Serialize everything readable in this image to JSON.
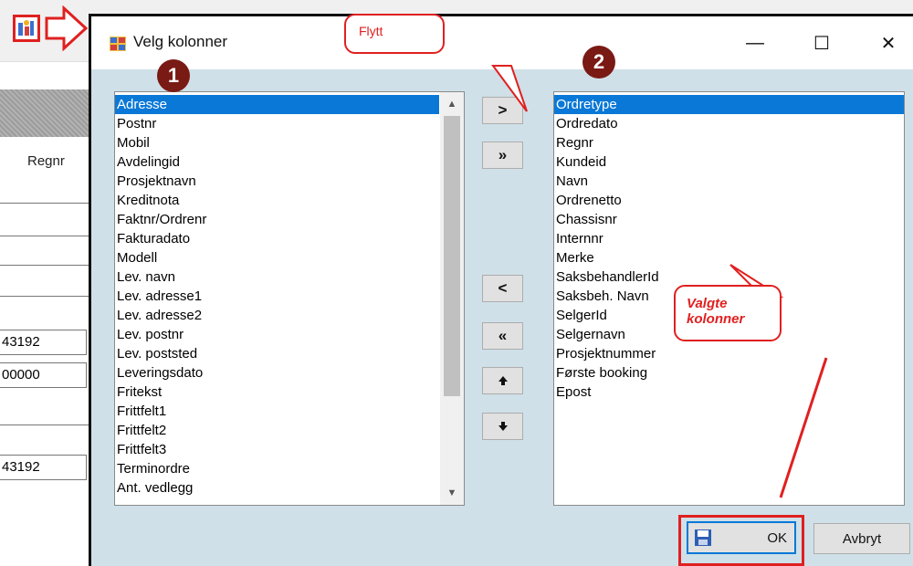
{
  "background": {
    "column_header": "Regnr",
    "cells": [
      "43192",
      "00000",
      "43192"
    ]
  },
  "dialog": {
    "title": "Velg kolonner",
    "window_controls": {
      "minimize": "—",
      "maximize": "☐",
      "close": "✕"
    }
  },
  "available_columns": {
    "badge": "1",
    "items": [
      "Adresse",
      "Postnr",
      "Mobil",
      "Avdelingid",
      "Prosjektnavn",
      "Kreditnota",
      "Faktnr/Ordrenr",
      "Fakturadato",
      "Modell",
      "Lev. navn",
      "Lev. adresse1",
      "Lev. adresse2",
      "Lev. postnr",
      "Lev. poststed",
      "Leveringsdato",
      "Fritekst",
      "Frittfelt1",
      "Frittfelt2",
      "Frittfelt3",
      "Terminordre",
      "Ant. vedlegg"
    ],
    "selected_index": 0
  },
  "chosen_columns": {
    "badge": "2",
    "items": [
      "Ordretype",
      "Ordredato",
      "Regnr",
      "Kundeid",
      "Navn",
      "Ordrenetto",
      "Chassisnr",
      "Internnr",
      "Merke",
      "SaksbehandlerId",
      "Saksbeh. Navn",
      "SelgerId",
      "Selgernavn",
      "Prosjektnummer",
      "Første booking",
      "Epost"
    ],
    "selected_index": 0
  },
  "move_buttons": {
    "move_right": ">",
    "move_all_right": "»",
    "move_left": "<",
    "move_all_left": "«",
    "move_up": "🡅",
    "move_down": "🡇"
  },
  "annotations": {
    "flytt": "Flytt",
    "valgte_line1": "Valgte",
    "valgte_line2": "kolonner"
  },
  "footer": {
    "ok_label": "OK",
    "cancel_label": "Avbryt"
  },
  "colors": {
    "selection": "#0a78d7",
    "annotation_red": "#e02020",
    "dialog_bg": "#cfe0e8",
    "badge": "#7a1a14"
  }
}
